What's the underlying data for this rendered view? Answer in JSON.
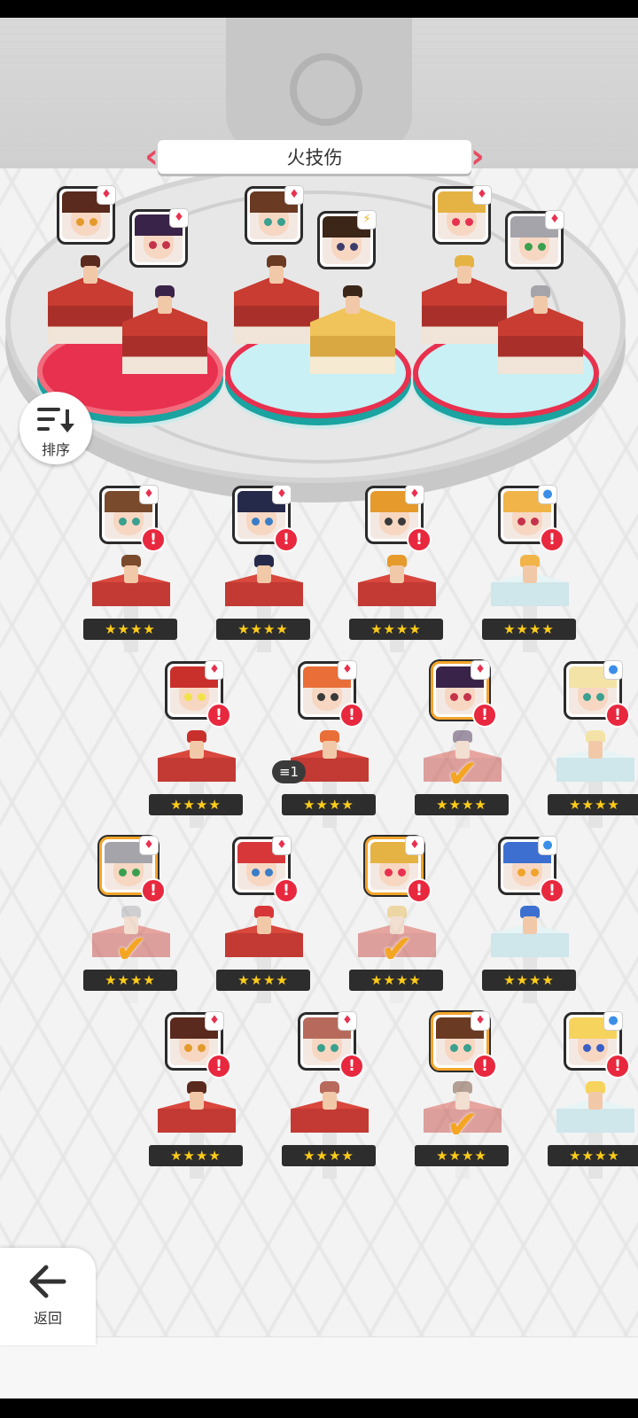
{
  "team_title": "火技伤",
  "sort_label": "排序",
  "back_label": "返回",
  "queue_count": "1",
  "rating_stars": "★★★★",
  "element_icons": {
    "fire": "♦",
    "water": "●",
    "lightning": "⚡"
  },
  "element_colors": {
    "fire": "#e8314f",
    "water": "#3b8fe8",
    "lightning": "#e9b21f"
  },
  "colors": {
    "accent": "#e84a62",
    "warning": "#e8283e",
    "selected": "#f4a623",
    "star": "#ffcc18"
  },
  "team_members": [
    {
      "name": "member-1",
      "element": "fire",
      "hair": "#5a2a1e",
      "eyes": "#e39a2b"
    },
    {
      "name": "member-2",
      "element": "fire",
      "hair": "#3a2348",
      "eyes": "#c5334b"
    },
    {
      "name": "member-3",
      "element": "fire",
      "hair": "#6a3a22",
      "eyes": "#3aa08f"
    },
    {
      "name": "member-4",
      "element": "lightning",
      "hair": "#3b2618",
      "eyes": "#3d3d6b"
    },
    {
      "name": "member-5",
      "element": "fire",
      "hair": "#e5b343",
      "eyes": "#e8314f"
    },
    {
      "name": "member-6",
      "element": "fire",
      "hair": "#a4a4aa",
      "eyes": "#3aa04f"
    }
  ],
  "roster": [
    {
      "element": "fire",
      "hair": "#7a4a2c",
      "eyes": "#3aa08f",
      "selected": false,
      "pedestal": "red"
    },
    {
      "element": "fire",
      "hair": "#262a4a",
      "eyes": "#3a7ec7",
      "selected": false,
      "pedestal": "red"
    },
    {
      "element": "fire",
      "hair": "#e59a2b",
      "eyes": "#3a3a3a",
      "selected": false,
      "pedestal": "red"
    },
    {
      "element": "water",
      "hair": "#f0b449",
      "eyes": "#c5334b",
      "selected": false,
      "pedestal": "cyan"
    },
    {
      "element": "fire",
      "hair": "#c9302b",
      "eyes": "#f2e24a",
      "selected": false,
      "pedestal": "red"
    },
    {
      "element": "fire",
      "hair": "#e96e38",
      "eyes": "#3a3a3a",
      "selected": false,
      "pedestal": "red"
    },
    {
      "element": "fire",
      "hair": "#3a2348",
      "eyes": "#c5334b",
      "selected": true,
      "pedestal": "red"
    },
    {
      "element": "water",
      "hair": "#f4e3a6",
      "eyes": "#3aa08f",
      "selected": false,
      "pedestal": "cyan"
    },
    {
      "element": "fire",
      "hair": "#a4a4aa",
      "eyes": "#3aa04f",
      "selected": true,
      "pedestal": "red"
    },
    {
      "element": "fire",
      "hair": "#d8373a",
      "eyes": "#3a7ec7",
      "selected": false,
      "pedestal": "red"
    },
    {
      "element": "fire",
      "hair": "#e5b343",
      "eyes": "#e8314f",
      "selected": true,
      "pedestal": "red"
    },
    {
      "element": "water",
      "hair": "#3c6fd0",
      "eyes": "#f0a42b",
      "selected": false,
      "pedestal": "cyan"
    },
    {
      "element": "fire",
      "hair": "#5a2a1e",
      "eyes": "#e39a2b",
      "selected": false,
      "pedestal": "red"
    },
    {
      "element": "fire",
      "hair": "#b76a5c",
      "eyes": "#3aa08f",
      "selected": false,
      "pedestal": "red"
    },
    {
      "element": "fire",
      "hair": "#6a3a22",
      "eyes": "#3aa08f",
      "selected": true,
      "pedestal": "red"
    },
    {
      "element": "water",
      "hair": "#f6d35c",
      "eyes": "#3a5ec7",
      "selected": false,
      "pedestal": "cyan"
    }
  ]
}
